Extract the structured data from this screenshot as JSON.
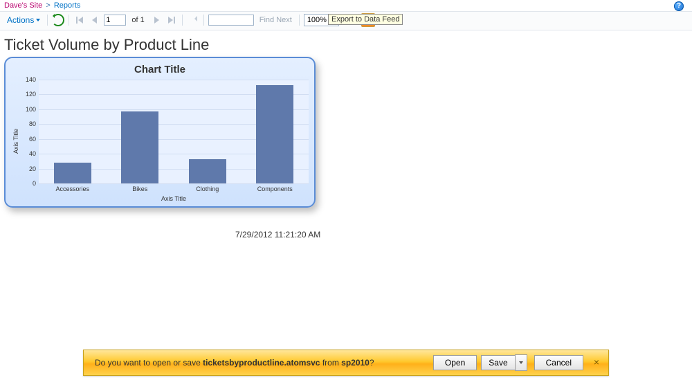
{
  "breadcrumb": {
    "site": "Dave's Site",
    "sep": ">",
    "page": "Reports"
  },
  "help_icon_glyph": "?",
  "toolbar": {
    "actions_label": "Actions",
    "page_current": "1",
    "page_of_label": "of",
    "page_total": "1",
    "find_next_label": "Find Next",
    "find_value": "",
    "zoom_value": "100%",
    "feed_tooltip": "Export to Data Feed"
  },
  "report": {
    "title": "Ticket Volume by Product Line",
    "chart_title": "Chart Title",
    "xaxis_title": "Axis Title",
    "yaxis_title": "Axis Title",
    "timestamp": "7/29/2012 11:21:20 AM"
  },
  "chart_data": {
    "type": "bar",
    "title": "Chart Title",
    "xlabel": "Axis Title",
    "ylabel": "Axis Title",
    "categories": [
      "Accessories",
      "Bikes",
      "Clothing",
      "Components"
    ],
    "values": [
      28,
      97,
      33,
      133
    ],
    "ylim": [
      0,
      140
    ],
    "yticks": [
      0,
      20,
      40,
      60,
      80,
      100,
      120,
      140
    ]
  },
  "download_bar": {
    "prefix": "Do you want to open or save ",
    "filename": "ticketsbyproductline.atomsvc",
    "from_label": " from ",
    "host": "sp2010",
    "suffix": "?",
    "open_label": "Open",
    "save_label": "Save",
    "cancel_label": "Cancel",
    "close_glyph": "×"
  }
}
